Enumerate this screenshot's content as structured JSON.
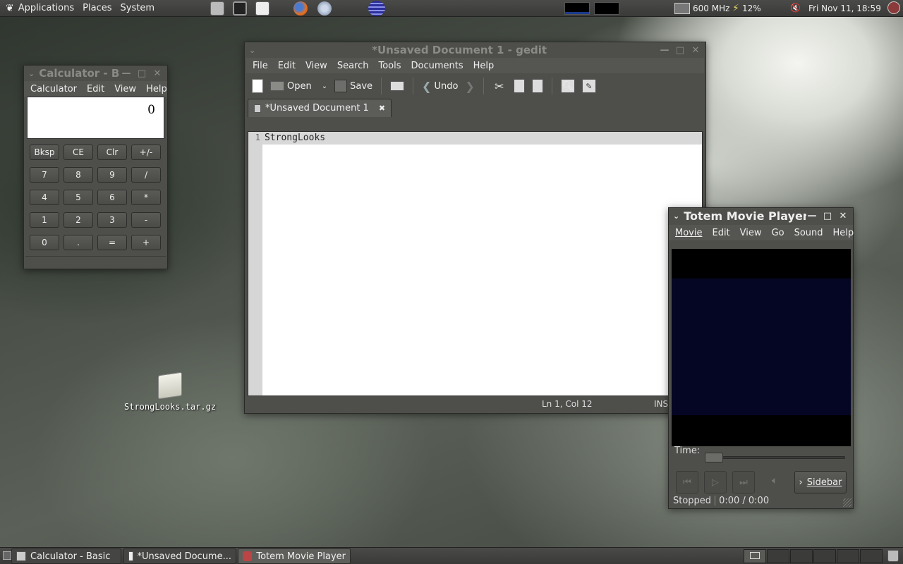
{
  "top_panel": {
    "menus": [
      "Applications",
      "Places",
      "System"
    ],
    "cpu_freq": "600 MHz",
    "battery": "12%",
    "clock": "Fri Nov 11, 18:59"
  },
  "calculator": {
    "title": "Calculator - B",
    "menus": [
      "Calculator",
      "Edit",
      "View",
      "Help"
    ],
    "display": "0",
    "keys": [
      "Bksp",
      "CE",
      "Clr",
      "+/-",
      "7",
      "8",
      "9",
      "/",
      "4",
      "5",
      "6",
      "*",
      "1",
      "2",
      "3",
      "-",
      "0",
      ".",
      "=",
      "+"
    ]
  },
  "gedit": {
    "title": "*Unsaved Document 1 - gedit",
    "menus": [
      "File",
      "Edit",
      "View",
      "Search",
      "Tools",
      "Documents",
      "Help"
    ],
    "toolbar": {
      "open": "Open",
      "save": "Save",
      "undo": "Undo"
    },
    "tab_label": "*Unsaved Document 1",
    "line_number": "1",
    "content": "StrongLooks",
    "status_pos": "Ln 1, Col 12",
    "status_mode": "INS"
  },
  "totem": {
    "title": "Totem Movie Player",
    "menus": [
      "Movie",
      "Edit",
      "View",
      "Go",
      "Sound",
      "Help"
    ],
    "time_label": "Time:",
    "seek_fraction": 0.0,
    "sidebar_label": "Sidebar",
    "status": "Stopped",
    "time": "0:00 / 0:00"
  },
  "desktop": {
    "file_label": "StrongLooks.tar.gz"
  },
  "taskbar": {
    "tasks": [
      "Calculator  - Basic",
      "*Unsaved Docume...",
      "Totem Movie Player"
    ]
  },
  "colors": {
    "panel": "#3a3a38",
    "window": "#4e4f4b",
    "video_mid": "#050623"
  }
}
